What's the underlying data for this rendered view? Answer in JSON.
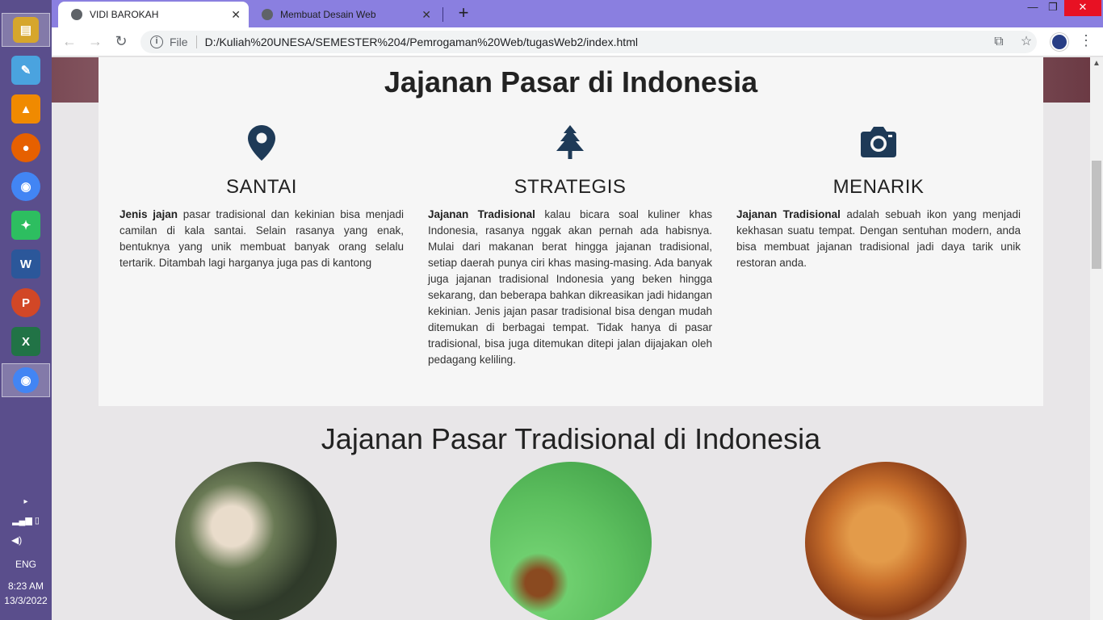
{
  "taskbar": {
    "apps": [
      {
        "name": "file-explorer",
        "color": "#d6a62c",
        "glyph": "▤"
      },
      {
        "name": "paint",
        "color": "#4aa3df",
        "glyph": "✎"
      },
      {
        "name": "vlc",
        "color": "#f08a00",
        "glyph": "▲"
      },
      {
        "name": "firefox",
        "color": "#e66000",
        "glyph": "●"
      },
      {
        "name": "chrome",
        "color": "#4285f4",
        "glyph": "◉"
      },
      {
        "name": "evernote",
        "color": "#2dbe60",
        "glyph": "✦"
      },
      {
        "name": "word",
        "color": "#2b579a",
        "glyph": "W"
      },
      {
        "name": "powerpoint",
        "color": "#d24726",
        "glyph": "P"
      },
      {
        "name": "excel",
        "color": "#217346",
        "glyph": "X"
      },
      {
        "name": "chrome-profile",
        "color": "#4285f4",
        "glyph": "◉"
      }
    ],
    "language": "ENG",
    "time": "8:23 AM",
    "date": "13/3/2022"
  },
  "browser": {
    "tabs": [
      {
        "title": "VIDI BAROKAH",
        "active": true
      },
      {
        "title": "Membuat Desain Web",
        "active": false
      }
    ],
    "new_tab": "+",
    "address": {
      "scheme_label": "File",
      "url": "D:/Kuliah%20UNESA/SEMESTER%204/Pemrogaman%20Web/tugasWeb2/index.html"
    }
  },
  "page": {
    "section1": {
      "title": "Jajanan Pasar di Indonesia",
      "columns": [
        {
          "icon": "map-marker",
          "heading": "SANTAI",
          "bold": "Jenis jajan",
          "text": " pasar tradisional dan kekinian bisa menjadi camilan di kala santai. Selain rasanya yang enak, bentuknya yang unik membuat banyak orang selalu tertarik. Ditambah lagi harganya juga pas di kantong"
        },
        {
          "icon": "tree",
          "heading": "STRATEGIS",
          "bold": "Jajanan Tradisional",
          "text": " kalau bicara soal kuliner khas Indonesia, rasanya nggak akan pernah ada habisnya. Mulai dari makanan berat hingga jajanan tradisional, setiap daerah punya ciri khas masing-masing. Ada banyak juga jajanan tradisional Indonesia yang beken hingga sekarang, dan beberapa bahkan dikreasikan jadi hidangan kekinian. Jenis jajan pasar tradisional bisa dengan mudah ditemukan di berbagai tempat. Tidak hanya di pasar tradisional, bisa juga ditemukan ditepi jalan dijajakan oleh pedagang keliling."
        },
        {
          "icon": "camera",
          "heading": "MENARIK",
          "bold": "Jajanan Tradisional",
          "text": " adalah sebuah ikon yang menjadi kekhasan suatu tempat. Dengan sentuhan modern, anda bisa membuat jajanan tradisional jadi daya tarik unik restoran anda."
        }
      ]
    },
    "section2": {
      "title": "Jajanan Pasar Tradisional di Indonesia",
      "images": [
        {
          "name": "lemper-in-banana-leaf-image"
        },
        {
          "name": "green-dadar-gulung-image"
        },
        {
          "name": "spring-rolls-with-chili-image"
        }
      ]
    }
  },
  "colors": {
    "icon": "#1e3a57",
    "tab_strip": "#8a7fe0",
    "taskbar": "#5a4e8c",
    "panel_bg": "#f6f6f6"
  }
}
